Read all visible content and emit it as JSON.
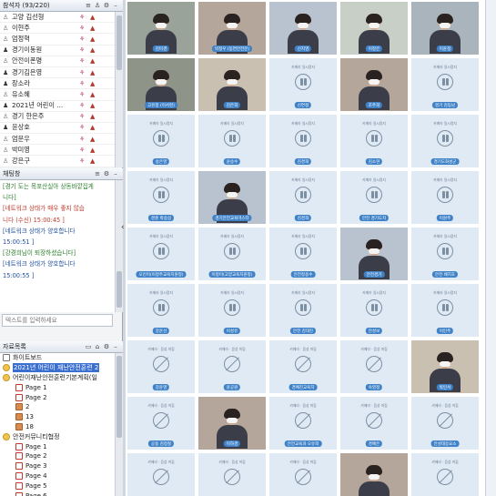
{
  "participants": {
    "title": "참석자 (93/220)",
    "toolbar_icons": [
      "list-icon",
      "person-icon",
      "settings-icon",
      "minimize-icon"
    ],
    "rows": [
      {
        "name": "고양 김선형",
        "host": false
      },
      {
        "name": "이현주",
        "host": false
      },
      {
        "name": "엄정혁",
        "host": false
      },
      {
        "name": "경기이동원",
        "host": true
      },
      {
        "name": "안전이폰명",
        "host": false
      },
      {
        "name": "경기김은영",
        "host": true
      },
      {
        "name": "장소라",
        "host": true
      },
      {
        "name": "유소혜",
        "host": false
      },
      {
        "name": "2021년 어린이 ...",
        "host": true
      },
      {
        "name": "경기 한은주",
        "host": false
      },
      {
        "name": "윤상호",
        "host": true
      },
      {
        "name": "엄문우",
        "host": false
      },
      {
        "name": "박미영",
        "host": false
      },
      {
        "name": "강은구",
        "host": false
      }
    ]
  },
  "chat": {
    "title": "채팅창",
    "messages": [
      {
        "text": "[경기 도는 목포산실아 상동바깥집게",
        "color": "green"
      },
      {
        "text": "니다]",
        "color": "green"
      },
      {
        "text": "[네트워크 상태가 매우 좋지 않습",
        "color": "red"
      },
      {
        "text": "니다 (수신) 15:00:45 ]",
        "color": "red"
      },
      {
        "text": "[네트워크 상태가 양호합니다",
        "color": "blue"
      },
      {
        "text": "15:00:51 ]",
        "color": "blue"
      },
      {
        "text": "[강경희님이 퇴장하셨습니다]",
        "color": "green"
      },
      {
        "text": "[네트워크 상태가 양호합니다",
        "color": "blue"
      },
      {
        "text": "15:00:55 ]",
        "color": "blue"
      }
    ],
    "input_placeholder": "텍스트를 입력하세요"
  },
  "files": {
    "title": "자료목록",
    "items": [
      {
        "label": "화이트보드",
        "indent": 0,
        "icon": "wb"
      },
      {
        "label": "2021년 어린이 재난안전훈련 2",
        "indent": 0,
        "icon": "folder",
        "selected": true
      },
      {
        "label": "어린이재난안전훈련기본계획(일",
        "indent": 0,
        "icon": "folder"
      },
      {
        "label": "Page 1",
        "indent": 1,
        "icon": "page"
      },
      {
        "label": "Page 2",
        "indent": 1,
        "icon": "page"
      },
      {
        "label": "2",
        "indent": 1,
        "icon": "pagefill"
      },
      {
        "label": "13",
        "indent": 1,
        "icon": "pagefill"
      },
      {
        "label": "18",
        "indent": 1,
        "icon": "pagefill"
      },
      {
        "label": "안전커뮤니티협정",
        "indent": 0,
        "icon": "folder"
      },
      {
        "label": "Page 1",
        "indent": 1,
        "icon": "page"
      },
      {
        "label": "Page 2",
        "indent": 1,
        "icon": "page"
      },
      {
        "label": "Page 3",
        "indent": 1,
        "icon": "page"
      },
      {
        "label": "Page 4",
        "indent": 1,
        "icon": "page"
      },
      {
        "label": "Page 5",
        "indent": 1,
        "icon": "page"
      },
      {
        "label": "Page 6",
        "indent": 1,
        "icon": "page"
      },
      {
        "label": "Page 7",
        "indent": 1,
        "icon": "page"
      }
    ]
  },
  "video_tiles": {
    "paused_caption": "카메라 일시정지",
    "off_caption": "카메라 · 음성 꺼짐",
    "tiles": [
      {
        "name": "김미경",
        "type": "cam"
      },
      {
        "name": "박정우 (동연안전분)",
        "type": "cam"
      },
      {
        "name": "신지영",
        "type": "cam"
      },
      {
        "name": "이정은",
        "type": "cam"
      },
      {
        "name": "이윤정",
        "type": "cam"
      },
      {
        "name": "고유정 (이서현)",
        "type": "cam"
      },
      {
        "name": "김은희",
        "type": "cam"
      },
      {
        "name": "신연정",
        "type": "pause"
      },
      {
        "name": "조주희",
        "type": "cam"
      },
      {
        "name": "경기 김동남",
        "type": "pause"
      },
      {
        "name": "송은영",
        "type": "pause"
      },
      {
        "name": "윤승수",
        "type": "pause"
      },
      {
        "name": "김경희",
        "type": "pause"
      },
      {
        "name": "김소현",
        "type": "pause"
      },
      {
        "name": "경기도화성군",
        "type": "pause"
      },
      {
        "name": "경준 박승섭",
        "type": "pause"
      },
      {
        "name": "경기안전교육마스터",
        "type": "cam"
      },
      {
        "name": "김경희",
        "type": "pause"
      },
      {
        "name": "안전 경기도지",
        "type": "pause"
      },
      {
        "name": "이원주",
        "type": "pause"
      },
      {
        "name": "오인미(이정주교육지원청)",
        "type": "pause"
      },
      {
        "name": "이정미(고양교육지원청)",
        "type": "pause"
      },
      {
        "name": "안전정용수",
        "type": "pause"
      },
      {
        "name": "안전경기",
        "type": "cam"
      },
      {
        "name": "안전 배지호",
        "type": "pause"
      },
      {
        "name": "강운선",
        "type": "pause"
      },
      {
        "name": "이성유",
        "type": "pause"
      },
      {
        "name": "안전 김대진",
        "type": "pause"
      },
      {
        "name": "안성보",
        "type": "pause"
      },
      {
        "name": "이인주",
        "type": "pause"
      },
      {
        "name": "강윤영",
        "type": "off"
      },
      {
        "name": "윤공원",
        "type": "off"
      },
      {
        "name": "경예진교육지",
        "type": "off"
      },
      {
        "name": "숙영정",
        "type": "off"
      },
      {
        "name": "박민서",
        "type": "cam"
      },
      {
        "name": "공용 김정철",
        "type": "off"
      },
      {
        "name": "이하경",
        "type": "cam"
      },
      {
        "name": "안전교육과 오유희",
        "type": "off"
      },
      {
        "name": "경예은",
        "type": "off"
      },
      {
        "name": "안성대응요소",
        "type": "off"
      },
      {
        "name": "",
        "type": "off"
      },
      {
        "name": "",
        "type": "off"
      },
      {
        "name": "",
        "type": "off"
      },
      {
        "name": "",
        "type": "cam"
      },
      {
        "name": "",
        "type": "off"
      }
    ]
  }
}
